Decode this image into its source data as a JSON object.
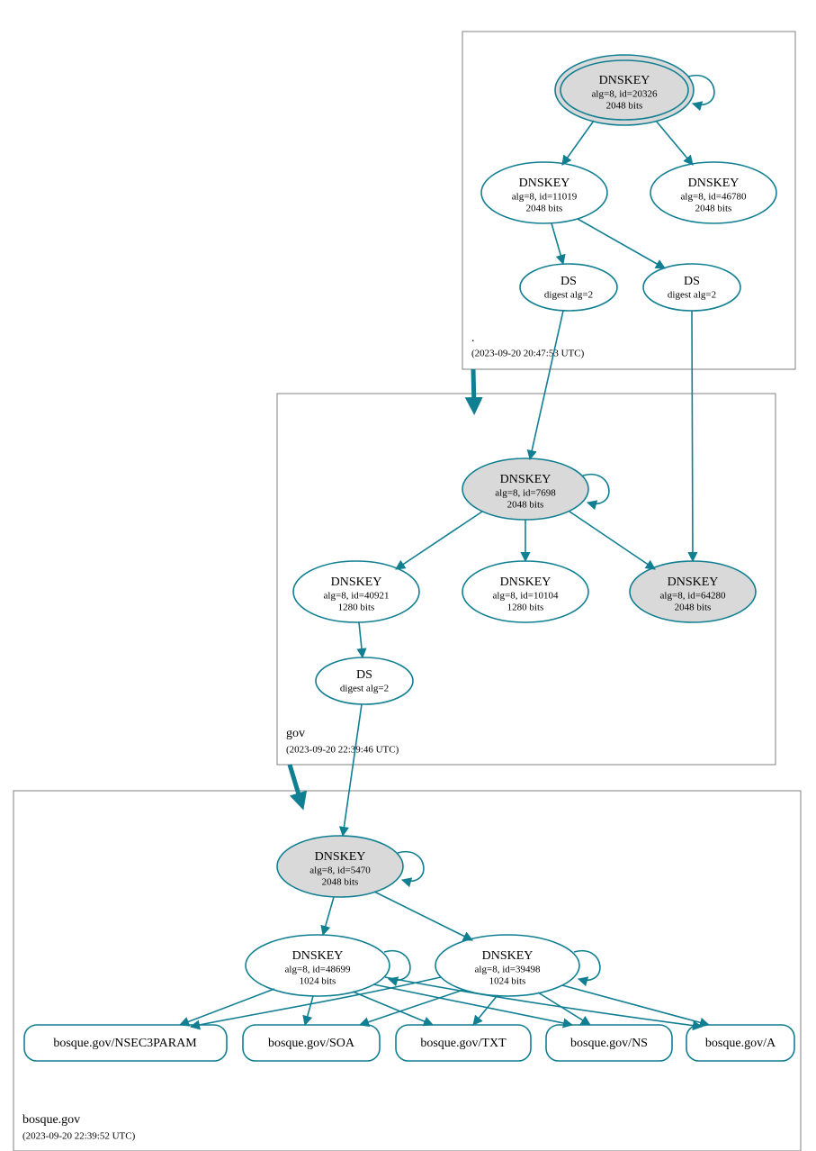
{
  "chart_data": {
    "type": "graph",
    "zones": [
      {
        "name": ".",
        "timestamp": "(2023-09-20 20:47:53 UTC)",
        "nodes": [
          {
            "id": "root-ksk",
            "type": "DNSKEY",
            "title": "DNSKEY",
            "line2": "alg=8, id=20326",
            "line3": "2048 bits",
            "highlight": true,
            "double_border": true,
            "self_loop": true
          },
          {
            "id": "root-zsk1",
            "type": "DNSKEY",
            "title": "DNSKEY",
            "line2": "alg=8, id=11019",
            "line3": "2048 bits",
            "highlight": false
          },
          {
            "id": "root-zsk2",
            "type": "DNSKEY",
            "title": "DNSKEY",
            "line2": "alg=8, id=46780",
            "line3": "2048 bits",
            "highlight": false
          },
          {
            "id": "root-ds1",
            "type": "DS",
            "title": "DS",
            "line2": "digest alg=2"
          },
          {
            "id": "root-ds2",
            "type": "DS",
            "title": "DS",
            "line2": "digest alg=2"
          }
        ],
        "edges": [
          {
            "from": "root-ksk",
            "to": "root-zsk1"
          },
          {
            "from": "root-ksk",
            "to": "root-zsk2"
          },
          {
            "from": "root-zsk1",
            "to": "root-ds1"
          },
          {
            "from": "root-zsk1",
            "to": "root-ds2"
          }
        ]
      },
      {
        "name": "gov",
        "timestamp": "(2023-09-20 22:39:46 UTC)",
        "nodes": [
          {
            "id": "gov-ksk",
            "type": "DNSKEY",
            "title": "DNSKEY",
            "line2": "alg=8, id=7698",
            "line3": "2048 bits",
            "highlight": true,
            "self_loop": true
          },
          {
            "id": "gov-zsk1",
            "type": "DNSKEY",
            "title": "DNSKEY",
            "line2": "alg=8, id=40921",
            "line3": "1280 bits",
            "highlight": false
          },
          {
            "id": "gov-zsk2",
            "type": "DNSKEY",
            "title": "DNSKEY",
            "line2": "alg=8, id=10104",
            "line3": "1280 bits",
            "highlight": false
          },
          {
            "id": "gov-zsk3",
            "type": "DNSKEY",
            "title": "DNSKEY",
            "line2": "alg=8, id=64280",
            "line3": "2048 bits",
            "highlight": true
          },
          {
            "id": "gov-ds",
            "type": "DS",
            "title": "DS",
            "line2": "digest alg=2"
          }
        ],
        "edges": [
          {
            "from": "gov-ksk",
            "to": "gov-zsk1"
          },
          {
            "from": "gov-ksk",
            "to": "gov-zsk2"
          },
          {
            "from": "gov-ksk",
            "to": "gov-zsk3"
          },
          {
            "from": "gov-zsk1",
            "to": "gov-ds"
          }
        ]
      },
      {
        "name": "bosque.gov",
        "timestamp": "(2023-09-20 22:39:52 UTC)",
        "nodes": [
          {
            "id": "bos-ksk",
            "type": "DNSKEY",
            "title": "DNSKEY",
            "line2": "alg=8, id=5470",
            "line3": "2048 bits",
            "highlight": true,
            "self_loop": true
          },
          {
            "id": "bos-zsk1",
            "type": "DNSKEY",
            "title": "DNSKEY",
            "line2": "alg=8, id=48699",
            "line3": "1024 bits",
            "highlight": false,
            "self_loop": true
          },
          {
            "id": "bos-zsk2",
            "type": "DNSKEY",
            "title": "DNSKEY",
            "line2": "alg=8, id=39498",
            "line3": "1024 bits",
            "highlight": false,
            "self_loop": true
          }
        ],
        "rrsets": [
          {
            "id": "rr-nsec3",
            "label": "bosque.gov/NSEC3PARAM"
          },
          {
            "id": "rr-soa",
            "label": "bosque.gov/SOA"
          },
          {
            "id": "rr-txt",
            "label": "bosque.gov/TXT"
          },
          {
            "id": "rr-ns",
            "label": "bosque.gov/NS"
          },
          {
            "id": "rr-a",
            "label": "bosque.gov/A"
          }
        ],
        "edges": [
          {
            "from": "bos-ksk",
            "to": "bos-zsk1"
          },
          {
            "from": "bos-ksk",
            "to": "bos-zsk2"
          },
          {
            "from": "bos-zsk1",
            "to": "rr-nsec3"
          },
          {
            "from": "bos-zsk1",
            "to": "rr-soa"
          },
          {
            "from": "bos-zsk1",
            "to": "rr-txt"
          },
          {
            "from": "bos-zsk1",
            "to": "rr-ns"
          },
          {
            "from": "bos-zsk1",
            "to": "rr-a"
          },
          {
            "from": "bos-zsk2",
            "to": "rr-nsec3"
          },
          {
            "from": "bos-zsk2",
            "to": "rr-soa"
          },
          {
            "from": "bos-zsk2",
            "to": "rr-txt"
          },
          {
            "from": "bos-zsk2",
            "to": "rr-ns"
          },
          {
            "from": "bos-zsk2",
            "to": "rr-a"
          }
        ]
      }
    ],
    "cross_zone_edges": [
      {
        "from": "root-ds1",
        "to": "gov-ksk"
      },
      {
        "from": "root-ds2",
        "to": "gov-zsk3"
      },
      {
        "from": "gov-ds",
        "to": "bos-ksk"
      }
    ],
    "zone_delegation_arrows": [
      {
        "from_zone": ".",
        "to_zone": "gov"
      },
      {
        "from_zone": "gov",
        "to_zone": "bosque.gov"
      }
    ]
  }
}
